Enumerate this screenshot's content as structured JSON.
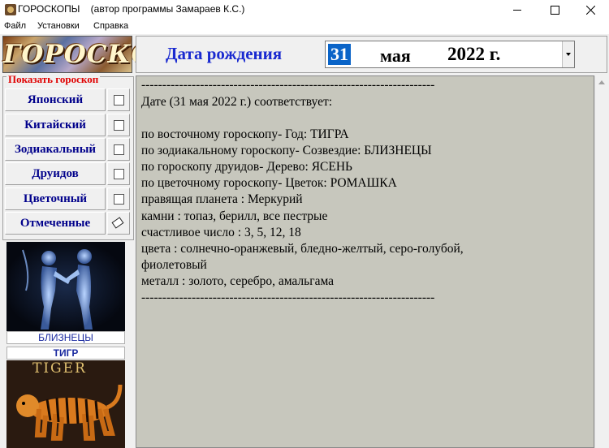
{
  "window": {
    "title": "ГОРОСКОПЫ    (автор программы Замараев К.С.)"
  },
  "menu": [
    "Файл",
    "Установки",
    "Справка"
  ],
  "logo_text": "ГОРОСКОП",
  "sidebar": {
    "legend": "Показать гороскоп",
    "buttons": [
      {
        "label": "Японский",
        "icon": "checkbox-icon"
      },
      {
        "label": "Китайский",
        "icon": "checkbox-icon"
      },
      {
        "label": "Зодиакальный",
        "icon": "checkbox-icon"
      },
      {
        "label": "Друидов",
        "icon": "checkbox-icon"
      },
      {
        "label": "Цветочный",
        "icon": "checkbox-icon"
      },
      {
        "label": "Отмеченные",
        "icon": "eraser-icon"
      }
    ],
    "zodiac_label": "БЛИЗНЕЦЫ",
    "east_label": "ТИГР",
    "tiger_caption": "TIGER"
  },
  "header": {
    "date_label": "Дата рождения",
    "day": "31",
    "month": "мая",
    "year": "2022 г."
  },
  "result": {
    "lines": [
      "----------------------------------------------------------------------",
      "Дате  (31 мая 2022 г.) соответствует:",
      "",
      "по восточному гороскопу- Год:  ТИГРА",
      "по зодиакальному гороскопу- Созвездие:  БЛИЗНЕЦЫ",
      "по гороскопу друидов- Дерево:  ЯСЕНЬ",
      "по цветочному гороскопу- Цветок:  РОМАШКА",
      "правящая планета :  Меркурий",
      "камни :  топаз, берилл, все пестрые",
      "счастливое число :  3, 5, 12, 18",
      "цвета :  солнечно-оранжевый, бледно-желтый, серо-голубой,",
      "фиолетовый",
      "металл :  золото, серебро, амальгама",
      "----------------------------------------------------------------------"
    ]
  },
  "colors": {
    "button_text": "#00008b",
    "legend_text": "#e00000",
    "date_label": "#1a2ad0",
    "result_bg": "#c7c7bd",
    "selection": "#0a64c8"
  }
}
